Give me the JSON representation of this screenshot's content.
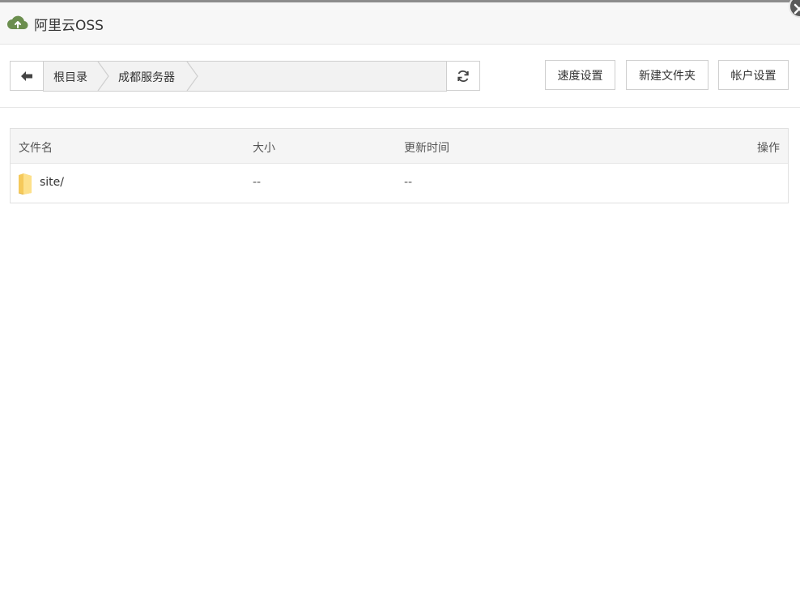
{
  "app": {
    "title": "阿里云OSS",
    "icon": "cloud-upload-icon",
    "accent": "#6b8e4e"
  },
  "toolbar": {
    "back_icon": "arrow-left-icon",
    "breadcrumbs": [
      "根目录",
      "成都服务器"
    ],
    "refresh_icon": "refresh-icon",
    "buttons": {
      "speed": "速度设置",
      "new_folder": "新建文件夹",
      "account": "帐户设置"
    }
  },
  "table": {
    "columns": [
      "文件名",
      "大小",
      "更新时间",
      "操作"
    ],
    "rows": [
      {
        "name": "site/",
        "size": "--",
        "updated": "--",
        "icon": "folder-icon"
      }
    ]
  }
}
